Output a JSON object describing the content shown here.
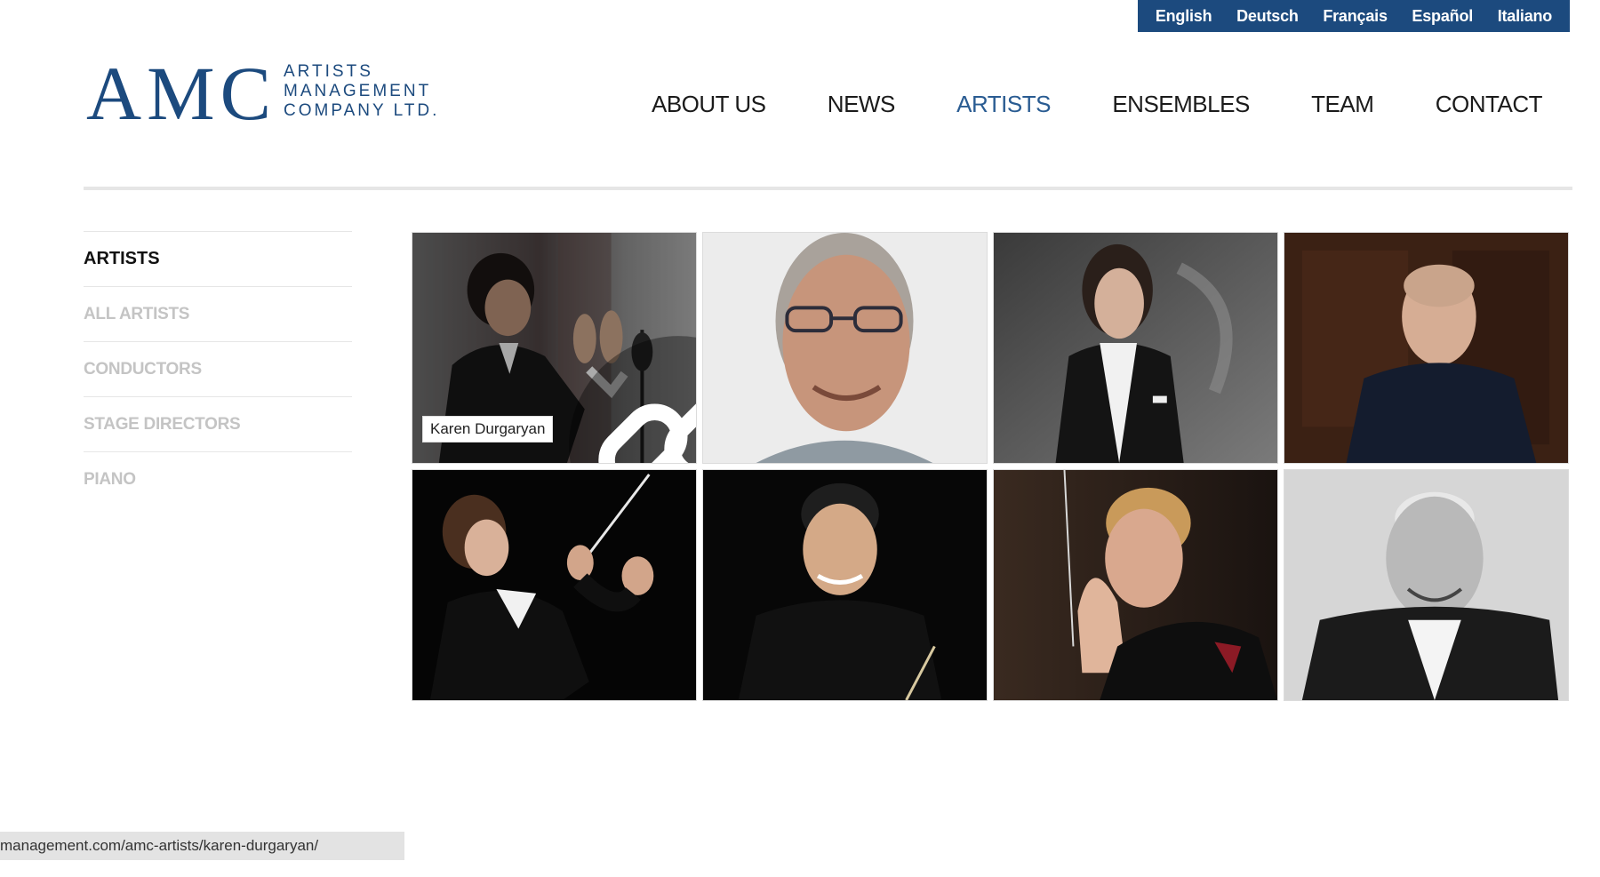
{
  "languages": [
    "English",
    "Deutsch",
    "Français",
    "Español",
    "Italiano"
  ],
  "logo": {
    "letters": "AMC",
    "line1": "ARTISTS",
    "line2": "MANAGEMENT",
    "line3": "COMPANY LTD."
  },
  "nav": {
    "items": [
      "ABOUT US",
      "NEWS",
      "ARTISTS",
      "ENSEMBLES",
      "TEAM",
      "CONTACT"
    ],
    "active": "ARTISTS"
  },
  "sidebar": {
    "heading": "ARTISTS",
    "items": [
      "ALL ARTISTS",
      "CONDUCTORS",
      "STAGE DIRECTORS",
      "PIANO"
    ]
  },
  "grid": {
    "hover_caption": "Karen Durgaryan"
  },
  "status_bar": {
    "url": "management.com/amc-artists/karen-durgaryan/"
  },
  "colors": {
    "brand": "#1c4a7e",
    "active_nav": "#2a5c92",
    "sidebar_inactive": "#c4c4c4"
  }
}
